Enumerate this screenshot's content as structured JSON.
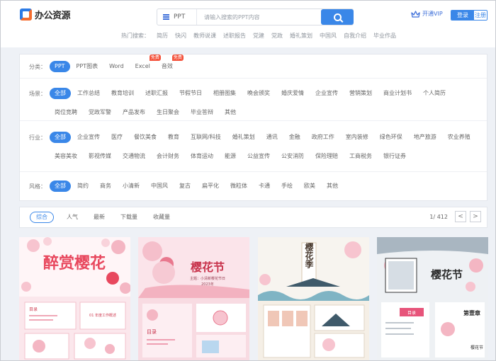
{
  "header": {
    "logo_text": "办公资源",
    "search": {
      "type": "PPT",
      "placeholder": "请输入搜索的PPT内容"
    },
    "hot_label": "热门搜索：",
    "hot_terms": [
      "简历",
      "快闪",
      "教师说课",
      "述职报告",
      "党建",
      "党政",
      "婚礼策划",
      "中国风",
      "自我介绍",
      "毕业作品"
    ],
    "vip_label": "开通VIP",
    "login_label": "登录",
    "register_label": "注册"
  },
  "filters": {
    "category": {
      "label": "分类：",
      "items": [
        {
          "label": "PPT",
          "active": true,
          "badge": ""
        },
        {
          "label": "PPT图表",
          "active": false,
          "badge": ""
        },
        {
          "label": "Word",
          "active": false,
          "badge": ""
        },
        {
          "label": "Excel",
          "active": false,
          "badge": "免费"
        },
        {
          "label": "音效",
          "active": false,
          "badge": "免费"
        }
      ]
    },
    "scene": {
      "label": "场景：",
      "items": [
        "全部",
        "工作总结",
        "教育培训",
        "述职汇报",
        "节假节日",
        "相册图集",
        "晚会颁奖",
        "婚庆爱情",
        "企业宣传",
        "营销策划",
        "商业计划书",
        "个人简历",
        "岗位竞聘",
        "党政军警",
        "产品发布",
        "生日聚会",
        "毕业答辩",
        "其他"
      ]
    },
    "industry": {
      "label": "行业：",
      "items": [
        "全部",
        "企业宣传",
        "医疗",
        "餐饮美食",
        "教育",
        "互联网/科技",
        "婚礼策划",
        "通讯",
        "金融",
        "政府工作",
        "室内装修",
        "绿色环保",
        "地产旅游",
        "农业养殖",
        "美容美妆",
        "影视传媒",
        "交通物流",
        "会计财务",
        "体育运动",
        "能源",
        "公益宣传",
        "公安消防",
        "保险理赔",
        "工商税务",
        "银行证券"
      ]
    },
    "style": {
      "label": "风格：",
      "items": [
        "全部",
        "简约",
        "商务",
        "小清新",
        "中国风",
        "复古",
        "扁平化",
        "微粒体",
        "卡通",
        "手绘",
        "欧美",
        "其他"
      ]
    }
  },
  "sortbar": {
    "items": [
      {
        "label": "综合",
        "active": true
      },
      {
        "label": "人气",
        "active": false
      },
      {
        "label": "最新",
        "active": false
      },
      {
        "label": "下载量",
        "active": false
      },
      {
        "label": "收藏量",
        "active": false
      }
    ],
    "page_info": "1/ 412",
    "prev": "<",
    "next": ">"
  },
  "cards": [
    {
      "title": "醉赏樱花",
      "sub": "目录",
      "sub2": "01 年度工作概述"
    },
    {
      "title": "樱花节",
      "sub": "目录",
      "sub2": "主题：小清新樱花节日",
      "sub3": "2023年"
    },
    {
      "title": "樱花季",
      "sub": "",
      "sub2": ""
    },
    {
      "title": "樱花节",
      "sub": "目录",
      "sub2": "第壹章",
      "sub3": "樱花节"
    }
  ],
  "colors": {
    "accent": "#3a87e8",
    "badge": "#f4523b",
    "pink": "#f7c4cf"
  }
}
